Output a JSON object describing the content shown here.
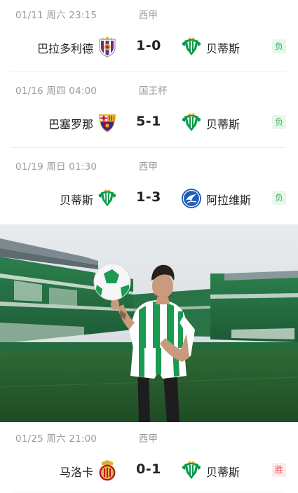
{
  "matches": [
    {
      "date": "01/11  周六 23:15",
      "competition": "西甲",
      "home": {
        "name": "巴拉多利德",
        "crest": "valladolid-crest-icon"
      },
      "score": "1-0",
      "away": {
        "name": "贝蒂斯",
        "crest": "betis-crest-icon"
      },
      "result": "负"
    },
    {
      "date": "01/16  周四 04:00",
      "competition": "国王杯",
      "home": {
        "name": "巴塞罗那",
        "crest": "barcelona-crest-icon"
      },
      "score": "5-1",
      "away": {
        "name": "贝蒂斯",
        "crest": "betis-crest-icon"
      },
      "result": "负"
    },
    {
      "date": "01/19  周日 01:30",
      "competition": "西甲",
      "home": {
        "name": "贝蒂斯",
        "crest": "betis-crest-icon"
      },
      "score": "1-3",
      "away": {
        "name": "阿拉维斯",
        "crest": "alaves-crest-icon"
      },
      "result": "负"
    },
    {
      "date": "01/25  周六 21:00",
      "competition": "西甲",
      "home": {
        "name": "马洛卡",
        "crest": "mallorca-crest-icon"
      },
      "score": "0-1",
      "away": {
        "name": "贝蒂斯",
        "crest": "betis-crest-icon"
      },
      "result": "胜"
    }
  ],
  "banner": {
    "subject": "player-with-football-photo"
  },
  "colors": {
    "betis_green": "#0b9a48",
    "loss_green": "#34b35a",
    "win_red": "#e8484a",
    "meta_gray": "#9a9a9a"
  }
}
